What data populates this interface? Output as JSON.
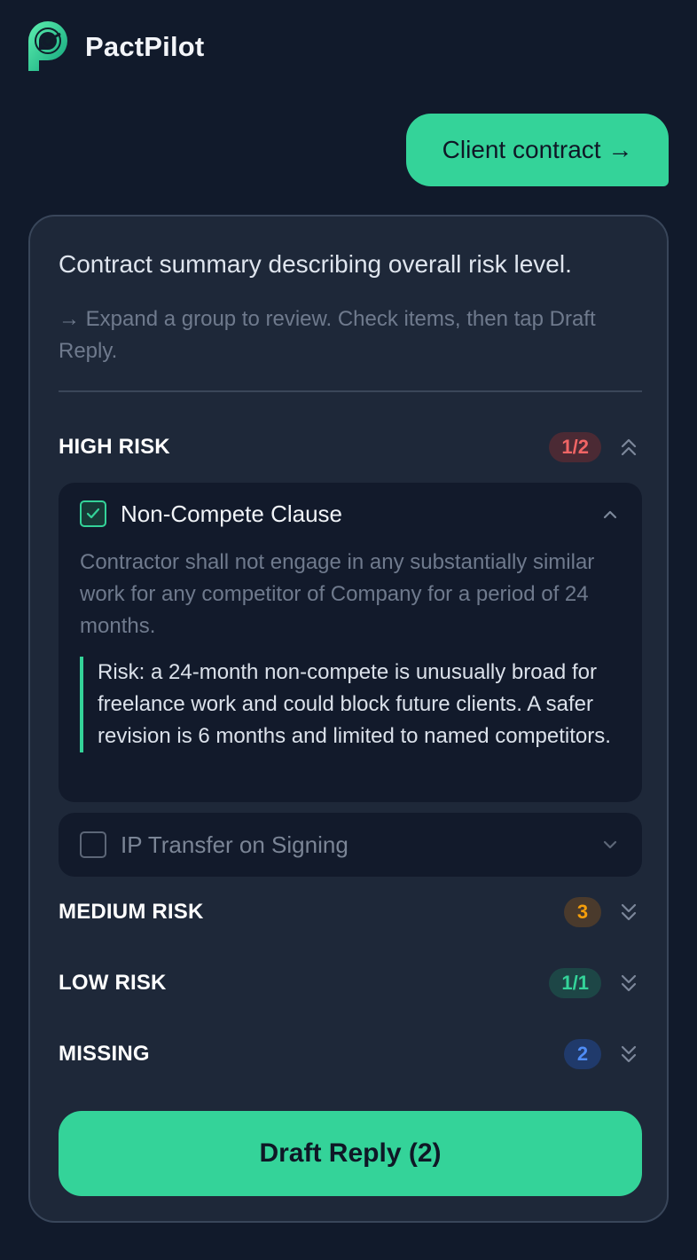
{
  "app": {
    "name": "PactPilot"
  },
  "message": {
    "text": "Client contract →"
  },
  "summary": {
    "text": "Contract summary describing overall risk level.",
    "hint": "→  Expand a group to review. Check items, then tap Draft Reply."
  },
  "groups": [
    {
      "title": "HIGH RISK",
      "badge": "1/2",
      "expanded": true
    },
    {
      "title": "MEDIUM RISK",
      "badge": "3",
      "expanded": false
    },
    {
      "title": "LOW RISK",
      "badge": "1/1",
      "expanded": false
    },
    {
      "title": "MISSING",
      "badge": "2",
      "expanded": false
    }
  ],
  "items": [
    {
      "title": "Non-Compete Clause",
      "checked": true,
      "expanded": true,
      "clause": "Contractor shall not engage in any substantially similar work for any competitor of Company for a period of 24 months.",
      "risk": "Risk: a 24-month non-compete is unusually broad for freelance work and could block future clients. A safer revision is 6 months and limited to named competitors."
    },
    {
      "title": "IP Transfer on Signing",
      "checked": false,
      "expanded": false
    }
  ],
  "actions": {
    "draft_reply": "Draft Reply (2)"
  },
  "colors": {
    "accent": "#34d399",
    "background": "#111a2b",
    "card": "#1e2839",
    "high": "#f06565",
    "medium": "#f59e0b",
    "low": "#34d399",
    "missing": "#4f8cf5"
  },
  "icons": {
    "logo": "pactpilot-logo-icon",
    "expand": "double-chevron-icon",
    "collapse": "chevron-icon",
    "check": "check-icon"
  }
}
